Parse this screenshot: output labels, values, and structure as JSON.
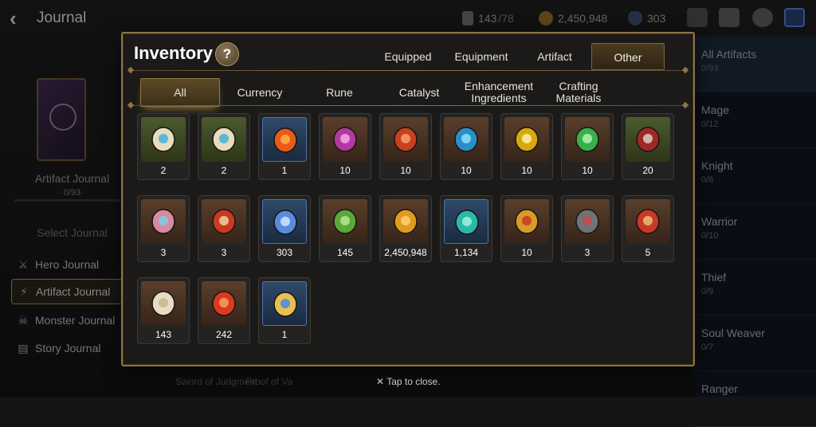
{
  "screen": {
    "back_icon": "chevron-left-icon",
    "title": "Journal",
    "resources": [
      {
        "icon": "stamina-icon",
        "value": "143",
        "max": "/78"
      },
      {
        "icon": "gold-icon",
        "value": "2,450,948"
      },
      {
        "icon": "crystal-icon",
        "value": "303"
      }
    ]
  },
  "left_panel": {
    "artifact_journal_label": "Artifact Journal",
    "artifact_journal_count": "0/93",
    "select_journal": "Select Journal",
    "menu": [
      {
        "label": "Hero Journal",
        "icon": "hero-icon"
      },
      {
        "label": "Artifact Journal",
        "icon": "lightning-icon"
      },
      {
        "label": "Monster Journal",
        "icon": "monster-icon"
      },
      {
        "label": "Story Journal",
        "icon": "book-icon"
      }
    ]
  },
  "right_panel": {
    "categories": [
      {
        "name": "All Artifacts",
        "count": "0/93"
      },
      {
        "name": "Mage",
        "count": "0/12"
      },
      {
        "name": "Knight",
        "count": "0/8"
      },
      {
        "name": "Warrior",
        "count": "0/10"
      },
      {
        "name": "Thief",
        "count": "0/9"
      },
      {
        "name": "Soul Weaver",
        "count": "0/7"
      },
      {
        "name": "Ranger",
        "count": ""
      }
    ]
  },
  "bottom_labels": [
    "Sword of Judgment",
    "Proof of Va"
  ],
  "modal": {
    "title": "Inventory",
    "help": "?",
    "tabs": [
      "Equipped",
      "Equipment",
      "Artifact",
      "Other"
    ],
    "active_tab": "Other",
    "subtabs": [
      "All",
      "Currency",
      "Rune",
      "Catalyst",
      "Enhancement Ingredients",
      "Crafting Materials"
    ],
    "active_subtab": "All",
    "items": [
      {
        "name": "rune-stone-icon",
        "qty": "2",
        "bg": "green",
        "color": "#e6dcc0",
        "accent": "#3fb3d8"
      },
      {
        "name": "rune-stone-icon",
        "qty": "2",
        "bg": "green",
        "color": "#e6dcc0",
        "accent": "#3fb3d8"
      },
      {
        "name": "fire-orb-icon",
        "qty": "1",
        "bg": "blue",
        "color": "#e85a1c",
        "accent": "#ffb347"
      },
      {
        "name": "purple-rune-icon",
        "qty": "10",
        "bg": "brown",
        "color": "#b03aa0",
        "accent": "#f5a8e8"
      },
      {
        "name": "red-rune-icon",
        "qty": "10",
        "bg": "brown",
        "color": "#c8401e",
        "accent": "#f4a070"
      },
      {
        "name": "blue-rune-icon",
        "qty": "10",
        "bg": "brown",
        "color": "#2a8fc8",
        "accent": "#8fe0ff"
      },
      {
        "name": "yellow-rune-icon",
        "qty": "10",
        "bg": "brown",
        "color": "#d8a812",
        "accent": "#fff0a0"
      },
      {
        "name": "green-rune-icon",
        "qty": "10",
        "bg": "brown",
        "color": "#38b04a",
        "accent": "#b4f5b0"
      },
      {
        "name": "claw-icon",
        "qty": "20",
        "bg": "green",
        "color": "#a02828",
        "accent": "#d8d0c0"
      },
      {
        "name": "charm-icon",
        "qty": "3",
        "bg": "brown",
        "color": "#d88aa0",
        "accent": "#7ad0e8"
      },
      {
        "name": "medal-icon",
        "qty": "3",
        "bg": "brown",
        "color": "#c83a22",
        "accent": "#f0d0a0"
      },
      {
        "name": "crystal-gem-icon",
        "qty": "303",
        "bg": "blue",
        "color": "#5a8ae0",
        "accent": "#d0e4ff"
      },
      {
        "name": "heart-leaf-icon",
        "qty": "145",
        "bg": "brown",
        "color": "#5aa83a",
        "accent": "#b8e890"
      },
      {
        "name": "gold-coin-icon",
        "qty": "2,450,948",
        "bg": "brown",
        "color": "#e09a22",
        "accent": "#ffd070"
      },
      {
        "name": "emerald-crystal-icon",
        "qty": "1,134",
        "bg": "blue",
        "color": "#2ab8a8",
        "accent": "#a0f0e0"
      },
      {
        "name": "gold-emblem-icon",
        "qty": "10",
        "bg": "brown",
        "color": "#d89a28",
        "accent": "#c83a22"
      },
      {
        "name": "stone-cube-icon",
        "qty": "3",
        "bg": "brown",
        "color": "#6e7478",
        "accent": "#c84a4a"
      },
      {
        "name": "red-banner-icon",
        "qty": "5",
        "bg": "brown",
        "color": "#c8382a",
        "accent": "#e8c070"
      },
      {
        "name": "chess-knight-icon",
        "qty": "143",
        "bg": "brown",
        "color": "#e8dcc4",
        "accent": "#c8b490"
      },
      {
        "name": "flame-mask-icon",
        "qty": "242",
        "bg": "brown",
        "color": "#d83a22",
        "accent": "#f8a060"
      },
      {
        "name": "star-pendant-icon",
        "qty": "1",
        "bg": "blue",
        "color": "#e8c050",
        "accent": "#4a8ae0"
      }
    ],
    "close_hint": "Tap to close.",
    "close_icon": "close-icon"
  }
}
